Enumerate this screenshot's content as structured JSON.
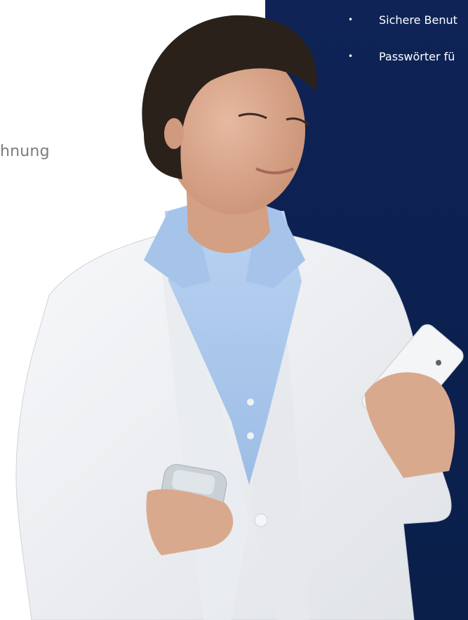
{
  "left_partial_text": "hnung",
  "panel": {
    "bullets": [
      {
        "label": "Sichere Benut"
      },
      {
        "label": "Passwörter fü"
      }
    ]
  },
  "photo": {
    "description_icon": "person-photo"
  },
  "colors": {
    "panel_navy": "#0c2150",
    "jacket_white": "#f2f3f5",
    "shirt_blue": "#a9c7ec",
    "hair_dark": "#2a211b",
    "skin": "#d8a98f",
    "left_text_gray": "#7c7c7c"
  }
}
